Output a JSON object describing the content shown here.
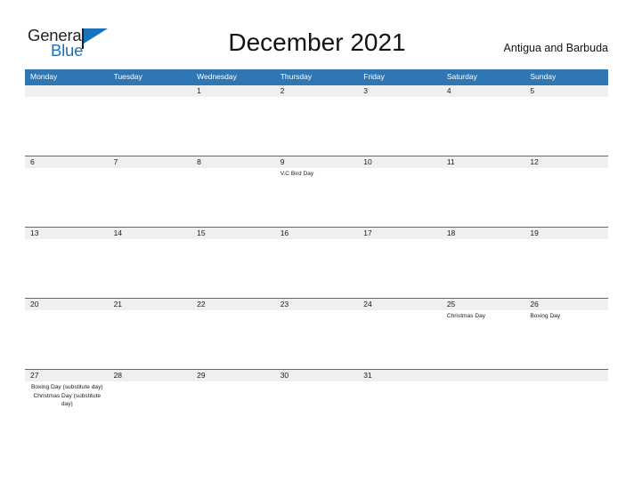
{
  "brand": {
    "word_one": "General",
    "word_two": "Blue",
    "flag_icon": "flag-icon",
    "accent_color": "#1c72b8"
  },
  "header": {
    "title": "December 2021",
    "region": "Antigua and Barbuda"
  },
  "colors": {
    "header_blue": "#2f76b5",
    "date_band_gray": "#efefef",
    "text": "#1a1a1a"
  },
  "weekdays": [
    "Monday",
    "Tuesday",
    "Wednesday",
    "Thursday",
    "Friday",
    "Saturday",
    "Sunday"
  ],
  "weeks": [
    [
      {
        "date": "",
        "events": []
      },
      {
        "date": "",
        "events": []
      },
      {
        "date": "1",
        "events": []
      },
      {
        "date": "2",
        "events": []
      },
      {
        "date": "3",
        "events": []
      },
      {
        "date": "4",
        "events": []
      },
      {
        "date": "5",
        "events": []
      }
    ],
    [
      {
        "date": "6",
        "events": []
      },
      {
        "date": "7",
        "events": []
      },
      {
        "date": "8",
        "events": []
      },
      {
        "date": "9",
        "events": [
          "V.C Bird Day"
        ]
      },
      {
        "date": "10",
        "events": []
      },
      {
        "date": "11",
        "events": []
      },
      {
        "date": "12",
        "events": []
      }
    ],
    [
      {
        "date": "13",
        "events": []
      },
      {
        "date": "14",
        "events": []
      },
      {
        "date": "15",
        "events": []
      },
      {
        "date": "16",
        "events": []
      },
      {
        "date": "17",
        "events": []
      },
      {
        "date": "18",
        "events": []
      },
      {
        "date": "19",
        "events": []
      }
    ],
    [
      {
        "date": "20",
        "events": []
      },
      {
        "date": "21",
        "events": []
      },
      {
        "date": "22",
        "events": []
      },
      {
        "date": "23",
        "events": []
      },
      {
        "date": "24",
        "events": []
      },
      {
        "date": "25",
        "events": [
          "Christmas Day"
        ]
      },
      {
        "date": "26",
        "events": [
          "Boxing Day"
        ]
      }
    ],
    [
      {
        "date": "27",
        "events": [
          "Boxing Day (substitute day)",
          "Christmas Day (substitute day)"
        ]
      },
      {
        "date": "28",
        "events": []
      },
      {
        "date": "29",
        "events": []
      },
      {
        "date": "30",
        "events": []
      },
      {
        "date": "31",
        "events": []
      },
      {
        "date": "",
        "events": []
      },
      {
        "date": "",
        "events": []
      }
    ]
  ]
}
